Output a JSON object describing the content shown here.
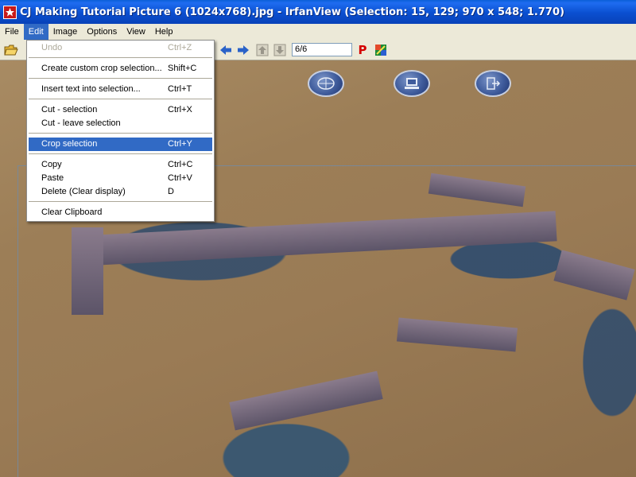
{
  "window": {
    "title": "CJ Making Tutorial Picture 6 (1024x768).jpg - IrfanView (Selection: 15, 129; 970 x 548; 1.770)"
  },
  "menubar": {
    "items": [
      {
        "label": "File"
      },
      {
        "label": "Edit",
        "active": true
      },
      {
        "label": "Image"
      },
      {
        "label": "Options"
      },
      {
        "label": "View"
      },
      {
        "label": "Help"
      }
    ]
  },
  "toolbar": {
    "page_indicator": "6/6",
    "p_label": "P",
    "icons": [
      "open-folder-icon",
      "prev-arrow-icon",
      "next-arrow-icon",
      "first-page-icon",
      "last-page-icon",
      "paint-icon"
    ]
  },
  "edit_menu": {
    "items": [
      {
        "label": "Undo",
        "shortcut": "Ctrl+Z",
        "disabled": true
      },
      {
        "label": "Create custom crop selection...",
        "shortcut": "Shift+C"
      },
      {
        "label": "Insert text into selection...",
        "shortcut": "Ctrl+T"
      },
      {
        "label": "Cut - selection",
        "shortcut": "Ctrl+X"
      },
      {
        "label": "Cut - leave selection",
        "shortcut": ""
      },
      {
        "label": "Crop selection",
        "shortcut": "Ctrl+Y",
        "selected": true
      },
      {
        "label": "Copy",
        "shortcut": "Ctrl+C"
      },
      {
        "label": "Paste",
        "shortcut": "Ctrl+V"
      },
      {
        "label": "Delete (Clear display)",
        "shortcut": "D"
      },
      {
        "label": "Clear Clipboard",
        "shortcut": ""
      }
    ]
  },
  "colors": {
    "titlebar": "#0a4fd0",
    "menu_highlight": "#316ac5",
    "menubar_bg": "#ece9d8"
  }
}
